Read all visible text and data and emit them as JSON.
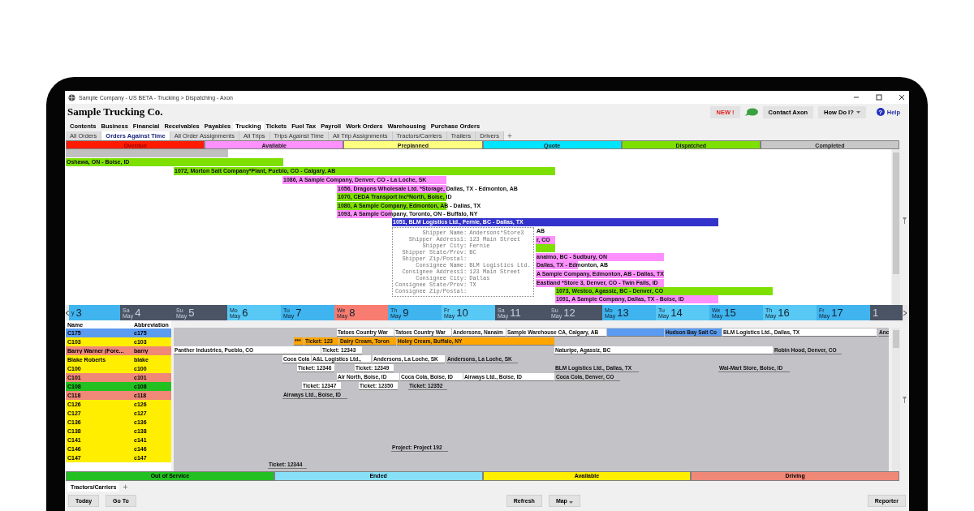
{
  "window": {
    "title": "Sample Company - US BETA - Trucking > Dispatching - Axon"
  },
  "header": {
    "company": "Sample Trucking Co.",
    "buttons": [
      {
        "kind": "new",
        "label": "NEW !"
      },
      {
        "kind": "chat"
      },
      {
        "kind": "plain",
        "label": "Contact Axon"
      },
      {
        "kind": "dropdown",
        "label": "How Do I?"
      },
      {
        "kind": "help",
        "label": "Help",
        "icon": "?"
      }
    ]
  },
  "menu": [
    {
      "label": "Contents",
      "selected": false
    },
    {
      "label": "Business",
      "selected": false
    },
    {
      "label": "Financial",
      "selected": false
    },
    {
      "label": "Receivables",
      "selected": false
    },
    {
      "label": "Payables",
      "selected": false
    },
    {
      "label": "Trucking",
      "selected": true
    },
    {
      "label": "Tickets",
      "selected": false
    },
    {
      "label": "Fuel Tax",
      "selected": false
    },
    {
      "label": "Payroll",
      "selected": false
    },
    {
      "label": "Work Orders",
      "selected": false
    },
    {
      "label": "Warehousing",
      "selected": false
    },
    {
      "label": "Purchase Orders",
      "selected": false
    }
  ],
  "tabs": [
    {
      "label": "All Orders",
      "selected": false
    },
    {
      "label": "Orders Against Time",
      "selected": true
    },
    {
      "label": "All Order Assignments",
      "selected": false
    },
    {
      "label": "All Trips",
      "selected": false
    },
    {
      "label": "Trips Against Time",
      "selected": false
    },
    {
      "label": "All Trip Assignments",
      "selected": false
    },
    {
      "label": "Tractors/Carriers",
      "selected": false
    },
    {
      "label": "Trailers",
      "selected": false
    },
    {
      "label": "Drivers",
      "selected": false
    }
  ],
  "tab_add": "+",
  "order_status_legend": [
    {
      "label": "Overdue",
      "color": "#ff1a00"
    },
    {
      "label": "Available",
      "color": "#ff90ff"
    },
    {
      "label": "Preplanned",
      "color": "#ffff80"
    },
    {
      "label": "Quote",
      "color": "#00e5ff"
    },
    {
      "label": "Dispatched",
      "color": "#7de000"
    },
    {
      "label": "Completed",
      "color": "#c8c8c8"
    }
  ],
  "gantt": {
    "bars": [
      {
        "color": "#c0c0c0"
      },
      {
        "label": "Oshawa, ON - Boise, ID",
        "color": "#7de000"
      },
      {
        "label": "1072, Morton Salt Company*Plant, Pueblo, CO - Calgary, AB",
        "color": "#7de000"
      },
      {
        "label": "1086, A Sample Company, Denver, CO - La Loche, SK",
        "color": "#ff90ff"
      },
      {
        "label": "1056, Dragons Wholesale Ltd. *Storage, Dallas, TX - Edmonton, AB",
        "color": "#ff90ff"
      },
      {
        "label": "1070, CEDA Transport Inc*North, Boise, ID",
        "color": "#7de000"
      },
      {
        "label": "1080, A Sample Company, Edmonton, AB - Dallas, TX",
        "color": "#7de000"
      },
      {
        "label": "1093, A Sample Company, Toronto, ON - Buffalo, NY",
        "color": "#ff90ff"
      },
      {
        "label": "1051, BLM Logistics Ltd., Fernie, BC - Dallas, TX",
        "color": "#3333cc"
      },
      {
        "label": "AB"
      },
      {
        "label": "r, CO",
        "color": "#ff90ff"
      },
      {
        "color": "#7de000"
      },
      {
        "label": "anaimo, BC - Sudbury, ON",
        "color": "#ff90ff"
      },
      {
        "label": "Dallas, TX - Edmonton, AB",
        "color": "#ff90ff"
      },
      {
        "label": "A Sample Company, Edmonton, AB - Dallas, TX",
        "color": "#ff90ff"
      },
      {
        "label": "Eastland *Store 3, Denver, CO - Twin Falls, ID",
        "color": "#ff90ff"
      },
      {
        "label": "1073, Westco, Agassiz, BC - Denver, CO",
        "color": "#7de000"
      },
      {
        "label": "1091, A Sample Company, Dallas, TX - Boise, ID",
        "color": "#ff90ff"
      }
    ],
    "tooltip": {
      "fields": [
        {
          "label": "Shipper Name:",
          "value": "Andersons*Store3"
        },
        {
          "label": "Shipper Address1:",
          "value": "123 Main Street"
        },
        {
          "label": "Shipper City:",
          "value": "Fernie"
        },
        {
          "label": "Shipper State/Prov:",
          "value": "BC"
        },
        {
          "label": "Shipper Zip/Postal:"
        },
        {
          "label": "Consignee Name:",
          "value": "BLM Logistics Ltd."
        },
        {
          "label": "Consignee Address1:",
          "value": "123 Main Street"
        },
        {
          "label": "Consignee City:",
          "value": "Dallas"
        },
        {
          "label": "Consignee State/Prov:",
          "value": "TX"
        },
        {
          "label": "Consignee Zip/Postal:"
        }
      ]
    }
  },
  "timeline": {
    "days": [
      {
        "month": "y",
        "day": "3",
        "kind": "weekday"
      },
      {
        "weekday": "Sa",
        "month": "May",
        "day": "4",
        "kind": "weekend"
      },
      {
        "weekday": "Su",
        "month": "May",
        "day": "5",
        "kind": "weekend"
      },
      {
        "weekday": "Mo",
        "month": "May",
        "day": "6",
        "kind": "weekday"
      },
      {
        "weekday": "Tu",
        "month": "May",
        "day": "7",
        "kind": "weekday"
      },
      {
        "weekday": "We",
        "month": "May",
        "day": "8",
        "kind": "today"
      },
      {
        "weekday": "Th",
        "month": "May",
        "day": "9",
        "kind": "weekday"
      },
      {
        "weekday": "Fr",
        "month": "May",
        "day": "10",
        "kind": "weekday"
      },
      {
        "weekday": "Sa",
        "month": "May",
        "day": "11",
        "kind": "weekend"
      },
      {
        "weekday": "Su",
        "month": "May",
        "day": "12",
        "kind": "weekend"
      },
      {
        "weekday": "Mo",
        "month": "May",
        "day": "13",
        "kind": "weekday"
      },
      {
        "weekday": "Tu",
        "month": "May",
        "day": "14",
        "kind": "weekday"
      },
      {
        "weekday": "We",
        "month": "May",
        "day": "15",
        "kind": "weekday"
      },
      {
        "weekday": "Th",
        "month": "May",
        "day": "16",
        "kind": "weekday"
      },
      {
        "weekday": "Fr",
        "month": "May",
        "day": "17",
        "kind": "weekday"
      },
      {
        "day": "1",
        "kind": "weekend"
      }
    ]
  },
  "resources": {
    "columns": [
      "Name",
      "Abbreviation"
    ],
    "rows": [
      {
        "name": "C175",
        "abbreviation": "c175",
        "color": "#5b9bf0"
      },
      {
        "name": "C103",
        "abbreviation": "c103",
        "color": "#ffee00"
      },
      {
        "name": "Barry Warner (Fore...",
        "abbreviation": "barry",
        "color": "#f08878"
      },
      {
        "name": "Blake Roberts",
        "abbreviation": "blake",
        "color": "#ffee00"
      },
      {
        "name": "C100",
        "abbreviation": "c100",
        "color": "#ffee00"
      },
      {
        "name": "C101",
        "abbreviation": "c101",
        "color": "#f08878"
      },
      {
        "name": "C108",
        "abbreviation": "c108",
        "color": "#22c020"
      },
      {
        "name": "C118",
        "abbreviation": "c118",
        "color": "#f08878"
      },
      {
        "name": "C126",
        "abbreviation": "c126",
        "color": "#ffee00"
      },
      {
        "name": "C127",
        "abbreviation": "c127",
        "color": "#ffee00"
      },
      {
        "name": "C136",
        "abbreviation": "c136",
        "color": "#ffee00"
      },
      {
        "name": "C138",
        "abbreviation": "c138",
        "color": "#ffee00"
      },
      {
        "name": "C141",
        "abbreviation": "c141",
        "color": "#ffee00"
      },
      {
        "name": "C146",
        "abbreviation": "c146",
        "color": "#ffee00"
      },
      {
        "name": "C147",
        "abbreviation": "c147",
        "color": "#ffee00"
      }
    ]
  },
  "assignments": [
    {
      "label": "Tatoes Country War",
      "color": "#ffffff"
    },
    {
      "label": "Tatoes Country War",
      "color": "#ffffff"
    },
    {
      "label": "Andersons, Nanaim",
      "color": "#ffffff"
    },
    {
      "label": "Sample Warehouse CA, Calgary, AB",
      "color": "#ffffff"
    },
    {
      "color": "#5b9bf0"
    },
    {
      "label": "Hudson Bay Salt Co",
      "color": "#5b9bf0"
    },
    {
      "label": "BLM Logistics Ltd., Dallas, TX",
      "color": "#ffffff"
    },
    {
      "label": "Anc",
      "color": "#c3c2c6"
    },
    {
      "label": "***",
      "color": "#ffa500"
    },
    {
      "label": "Ticket: 123",
      "color": "#ffa500"
    },
    {
      "label": "Dairy Cream, Toron",
      "color": "#ffa500"
    },
    {
      "label": "Holey Cream, Buffalo, NY",
      "color": "#ffa500"
    },
    {
      "label": "Panther Industries, Pueblo, CO",
      "color": "#ffffff"
    },
    {
      "label": "Ticket: 12343",
      "color": "#ffffff"
    },
    {
      "label": "Naturipe, Agassiz, BC",
      "color": "#ffffff"
    },
    {
      "label": "Robin Hood, Denver, CO",
      "color": "#c3c2c6"
    },
    {
      "label": "Coca Cola",
      "color": "#ffffff"
    },
    {
      "label": "A&L Logistics Ltd.,",
      "color": "#ffffff"
    },
    {
      "label": "Andersons, La Loche, SK",
      "color": "#ffffff"
    },
    {
      "label": "Andersons, La Loche, SK",
      "color": "#c3c2c6"
    },
    {
      "label": "Ticket: 12346",
      "color": "#ffffff"
    },
    {
      "label": "Ticket: 12349",
      "color": "#ffffff"
    },
    {
      "label": "BLM Logistics Ltd., Dallas, TX",
      "color": "#c3c2c6"
    },
    {
      "label": "Wal-Mart Store, Boise, ID",
      "color": "#c3c2c6"
    },
    {
      "label": "Air North, Boise, ID",
      "color": "#ffffff"
    },
    {
      "label": "Coca Cola, Boise, ID",
      "color": "#ffffff"
    },
    {
      "label": "Airways Ltd., Boise, ID",
      "color": "#ffffff"
    },
    {
      "label": "Coca Cola, Denver, CO",
      "color": "#c3c2c6"
    },
    {
      "label": "Ticket: 12347",
      "color": "#ffffff"
    },
    {
      "label": "Ticket: 12350",
      "color": "#ffffff"
    },
    {
      "label": "Ticket: 12352",
      "color": "#c3c2c6"
    },
    {
      "label": "Airways Ltd., Boise, ID",
      "color": "#c3c2c6"
    },
    {
      "label": "Project: Project 192",
      "color": "#c3c2c6"
    },
    {
      "label": "Ticket: 12344",
      "color": "#c3c2c6"
    }
  ],
  "resource_status_legend": [
    {
      "label": "Out of Service",
      "color": "#22c020"
    },
    {
      "label": "Ended",
      "color": "#88e0f8"
    },
    {
      "label": "Available",
      "color": "#ffee00"
    },
    {
      "label": "Driving",
      "color": "#f08878"
    }
  ],
  "bottom_tabs": [
    {
      "label": "Tractors/Carriers",
      "selected": true
    }
  ],
  "bottom_tab_add": "+",
  "toolbar": [
    {
      "label": "Today"
    },
    {
      "label": "Go To"
    },
    {
      "label": "Refresh"
    },
    {
      "label": "Map",
      "dropdown": true
    },
    {
      "label": "Reporter"
    }
  ]
}
